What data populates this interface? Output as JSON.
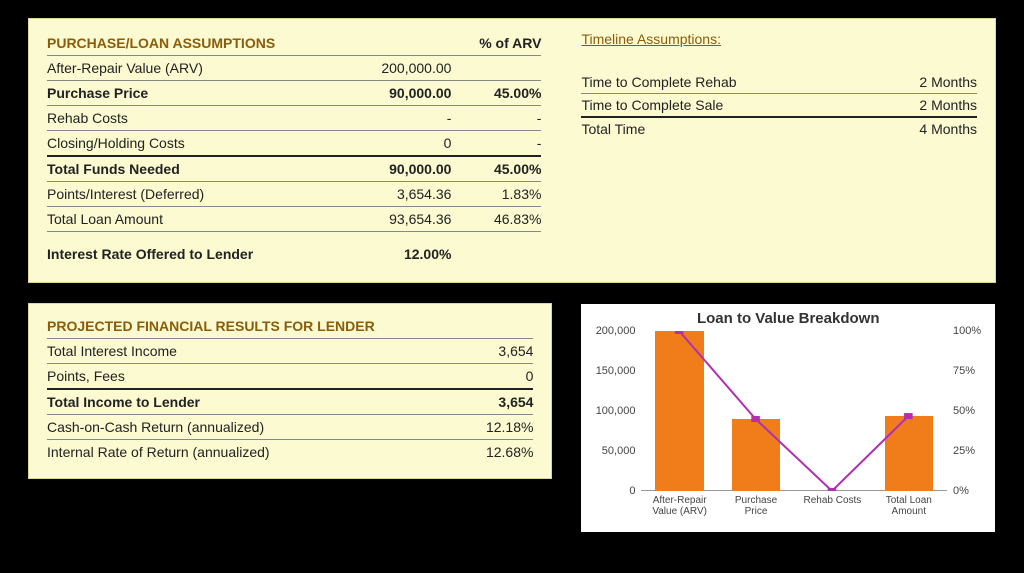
{
  "loan": {
    "title": "PURCHASE/LOAN ASSUMPTIONS",
    "pct_header": "% of ARV",
    "rows": {
      "arv": {
        "label": "After-Repair Value (ARV)",
        "value": "200,000.00",
        "pct": ""
      },
      "price": {
        "label": "Purchase Price",
        "value": "90,000.00",
        "pct": "45.00%"
      },
      "rehab": {
        "label": "Rehab Costs",
        "value": "-",
        "pct": "-"
      },
      "closing": {
        "label": "Closing/Holding Costs",
        "value": "0",
        "pct": "-"
      },
      "funds": {
        "label": "Total Funds Needed",
        "value": "90,000.00",
        "pct": "45.00%"
      },
      "points": {
        "label": "Points/Interest (Deferred)",
        "value": "3,654.36",
        "pct": "1.83%"
      },
      "total_loan": {
        "label": "Total Loan Amount",
        "value": "93,654.36",
        "pct": "46.83%"
      },
      "rate": {
        "label": "Interest Rate Offered to Lender",
        "value": "12.00%",
        "pct": ""
      }
    }
  },
  "timeline": {
    "title": "Timeline Assumptions:",
    "rows": {
      "rehab": {
        "label": "Time to Complete Rehab",
        "value": "2 Months"
      },
      "sale": {
        "label": "Time to Complete Sale",
        "value": "2 Months"
      },
      "total": {
        "label": "Total Time",
        "value": "4 Months"
      }
    }
  },
  "results": {
    "title": "PROJECTED FINANCIAL RESULTS FOR LENDER",
    "rows": {
      "interest": {
        "label": "Total Interest Income",
        "value": "3,654"
      },
      "fees": {
        "label": "Points, Fees",
        "value": "0"
      },
      "income": {
        "label": "Total Income to Lender",
        "value": "3,654"
      },
      "coc": {
        "label": "Cash-on-Cash Return (annualized)",
        "value": "12.18%"
      },
      "irr": {
        "label": "Internal Rate of Return (annualized)",
        "value": "12.68%"
      }
    }
  },
  "chart_data": {
    "type": "bar",
    "title": "Loan to Value Breakdown",
    "categories": [
      "After-Repair Value (ARV)",
      "Purchase Price",
      "Rehab Costs",
      "Total Loan Amount"
    ],
    "bar_values": [
      200000,
      90000,
      0,
      93654
    ],
    "bar_ylim": [
      0,
      200000
    ],
    "bar_ticks": [
      0,
      50000,
      100000,
      150000,
      200000
    ],
    "bar_tick_labels": [
      "0",
      "50,000",
      "100,000",
      "150,000",
      "200,000"
    ],
    "line_pct_values": [
      100,
      45,
      0,
      46.83
    ],
    "pct_ylim": [
      0,
      100
    ],
    "pct_ticks": [
      0,
      25,
      50,
      75,
      100
    ],
    "pct_tick_labels": [
      "0%",
      "25%",
      "50%",
      "75%",
      "100%"
    ],
    "bar_color": "#f07d1a",
    "line_color": "#b030b0"
  }
}
